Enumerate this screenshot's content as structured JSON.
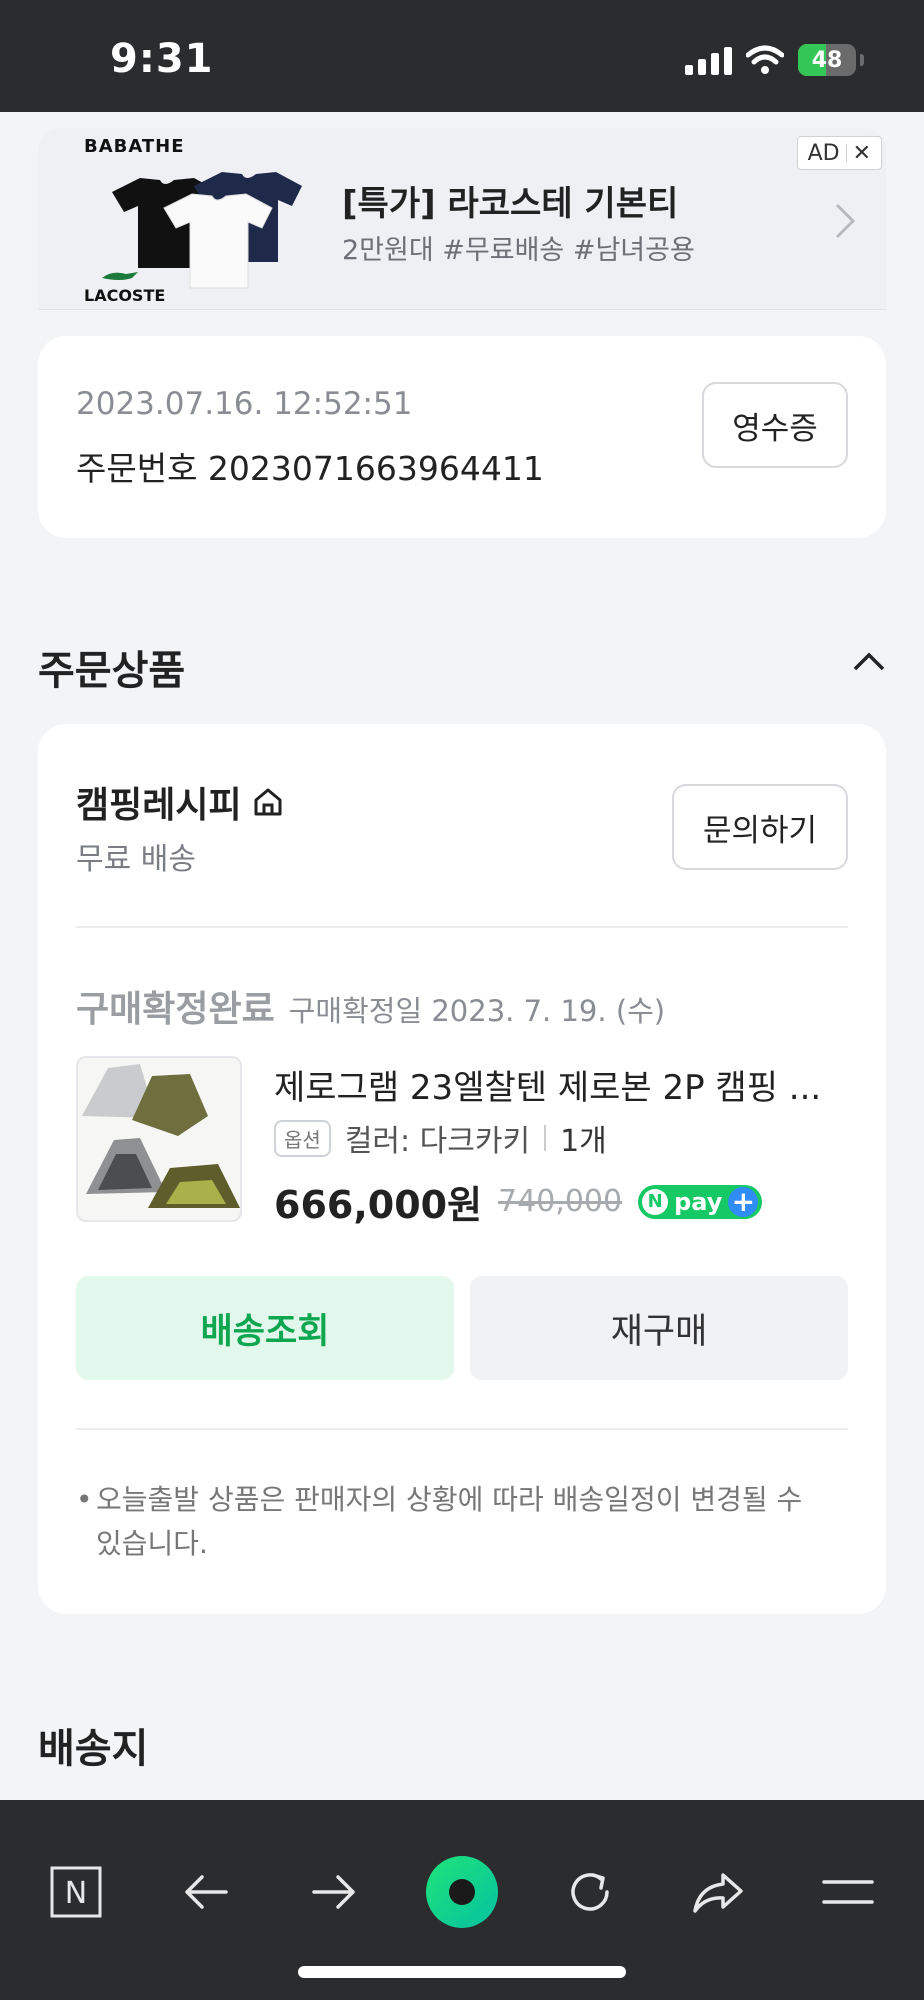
{
  "status_bar": {
    "time": "9:31",
    "battery": "48",
    "battery_level": 0.48
  },
  "ad": {
    "brand_top": "BABATHE",
    "brand_bottom": "LACOSTE",
    "title": "[특가] 라코스테 기본티",
    "subtitle": "2만원대  #무료배송 #남녀공용",
    "badge": "AD",
    "close": "✕"
  },
  "order": {
    "date": "2023.07.16. 12:52:51",
    "number": "주문번호 2023071663964411",
    "receipt_label": "영수증"
  },
  "products_section": {
    "title": "주문상품"
  },
  "seller": {
    "name": "캠핑레시피",
    "shipping": "무료 배송",
    "inquiry_label": "문의하기"
  },
  "item": {
    "status": "구매확정완료",
    "confirm_date": "구매확정일 2023. 7. 19. (수)",
    "name": "제로그램 23엘찰텐 제로본 2P 캠핑 ...",
    "option_tag": "옵션",
    "option": "컬러: 다크카키",
    "quantity": "1개",
    "price": "666,000원",
    "original_price": "740,000",
    "npay_n": "N",
    "npay_text": "pay"
  },
  "actions": {
    "track": "배송조회",
    "rebuy": "재구매"
  },
  "notice": "오늘출발 상품은 판매자의 상황에 따라 배송일정이 변경될 수 있습니다.",
  "address_section": {
    "title": "배송지"
  },
  "toolbar": {
    "naver": "N"
  },
  "colors": {
    "brand_green": "#17c964",
    "track_text": "#0fa650",
    "track_bg": "#e3f8ec",
    "bar_bg": "#2b2c2e"
  }
}
